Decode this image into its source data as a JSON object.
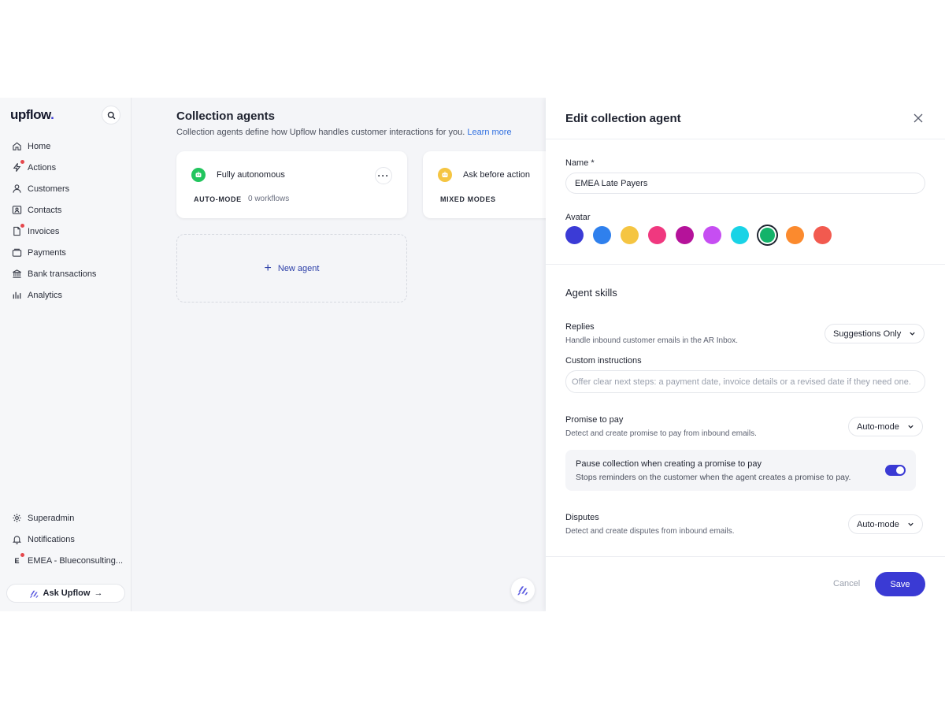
{
  "sidebar": {
    "logo": "upflow",
    "logo_mark": ".",
    "items": [
      {
        "label": "Home",
        "icon": "home-icon",
        "alert": false
      },
      {
        "label": "Actions",
        "icon": "lightning-icon",
        "alert": true
      },
      {
        "label": "Customers",
        "icon": "user-icon",
        "alert": false
      },
      {
        "label": "Contacts",
        "icon": "contact-card-icon",
        "alert": false
      },
      {
        "label": "Invoices",
        "icon": "document-icon",
        "alert": true
      },
      {
        "label": "Payments",
        "icon": "wallet-icon",
        "alert": false
      },
      {
        "label": "Bank transactions",
        "icon": "bank-icon",
        "alert": false
      },
      {
        "label": "Analytics",
        "icon": "bar-chart-icon",
        "alert": false
      }
    ],
    "bottom": {
      "superadmin": "Superadmin",
      "notifications": "Notifications",
      "org_initial": "E",
      "org_name": "EMEA - Blueconsulting..."
    },
    "ask_button": "Ask Upflow",
    "ask_arrow": "→"
  },
  "main": {
    "title": "Collection agents",
    "subtitle": "Collection agents define how Upflow handles customer interactions for you.",
    "learn_more": "Learn more",
    "cards": [
      {
        "title": "Fully autonomous",
        "mode": "AUTO-MODE",
        "workflows": "0 workflows",
        "icon_color": "#22c55e",
        "more": "···"
      },
      {
        "title": "Ask before action",
        "mode": "MIXED MODES",
        "workflows": "",
        "icon_color": "#f5c542"
      }
    ],
    "new_agent": "New agent",
    "new_agent_plus": "+"
  },
  "panel": {
    "title": "Edit collection agent",
    "name_label": "Name *",
    "name_value": "EMEA Late Payers",
    "avatar_label": "Avatar",
    "avatar_colors": [
      "#3b3bd6",
      "#2f80ed",
      "#f5c542",
      "#f0387f",
      "#b5129a",
      "#c64ef2",
      "#19d3e6",
      "#13b36a",
      "#fb8a2e",
      "#f25a4f"
    ],
    "avatar_selected_index": 7,
    "skills_title": "Agent skills",
    "replies": {
      "label": "Replies",
      "desc": "Handle inbound customer emails in the AR Inbox.",
      "value": "Suggestions Only"
    },
    "custom_instructions": {
      "label": "Custom instructions",
      "placeholder": "Offer clear next steps: a payment date, invoice details or a revised date if they need one."
    },
    "promise": {
      "label": "Promise to pay",
      "desc": "Detect and create promise to pay from inbound emails.",
      "value": "Auto-mode"
    },
    "pause": {
      "title": "Pause collection when creating a promise to pay",
      "desc": "Stops reminders on the customer when the agent creates a promise to pay.",
      "enabled": true
    },
    "disputes": {
      "label": "Disputes",
      "desc": "Detect and create disputes from inbound emails.",
      "value": "Auto-mode"
    },
    "cancel": "Cancel",
    "save": "Save"
  },
  "colors": {
    "accent": "#3a3ad4",
    "link": "#2f6fe0",
    "alert": "#e5484d"
  }
}
